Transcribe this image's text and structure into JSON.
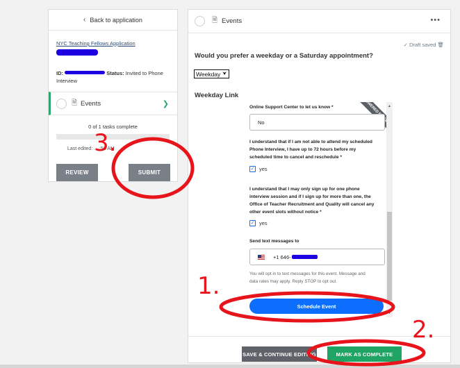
{
  "left_panel": {
    "back_label": "Back to application",
    "app_title": "NYC Teaching Fellows Application",
    "id_label": "ID:",
    "status_label": "Status:",
    "status_value": "Invited to Phone Interview",
    "events_label": "Events",
    "tasks_complete": "0 of 1 tasks complete",
    "progress_fraction": 0,
    "last_edited_prefix": "Last edited:",
    "last_edited_value": "... :56 AM",
    "review_label": "REVIEW",
    "submit_label": "SUBMIT"
  },
  "right_panel": {
    "header_title": "Events",
    "more_label": "•••",
    "draft_saved": "✓ Draft saved 🗑",
    "question": "Would you prefer a weekday or a Saturday appointment?",
    "selected_option": "Weekday",
    "link_label": "Weekday Link"
  },
  "calendly_form": {
    "ribbon_text": "POWERED BY Calendly",
    "q1_label": "Online Support Center to let us know *",
    "q1_value": "No",
    "q2_line1": "I understand that if I am not able to attend my scheduled",
    "q2_line2": "Phone Interview, I have up to 72 hours before my",
    "q2_line3": "scheduled time to cancel and reschedule *",
    "q2_answer": "yes",
    "q3_line1": "I understand that I may only sign up for one phone",
    "q3_line2": "interview session and if I sign up for more than one, the",
    "q3_line3": "Office of Teacher Recruitment and Quality will cancel any",
    "q3_line4": "other event slots without notice *",
    "q3_answer": "yes",
    "sms_label": "Send text messages to",
    "phone_prefix": "+1 646-",
    "opt_in_line1": "You will opt in to text messages for this event. Message and",
    "opt_in_line2": "data rates may apply. Reply STOP to opt out.",
    "schedule_label": "Schedule Event"
  },
  "footer": {
    "save_label": "SAVE & CONTINUE EDITING",
    "complete_label": "MARK AS COMPLETE"
  },
  "annotations": {
    "one": "1.",
    "two": "2.",
    "three": "3."
  },
  "colors": {
    "green_accent": "#2ea66d",
    "annotation_red": "#e8141b",
    "redaction_blue": "#1c00e0",
    "primary_blue": "#0d6efd"
  }
}
